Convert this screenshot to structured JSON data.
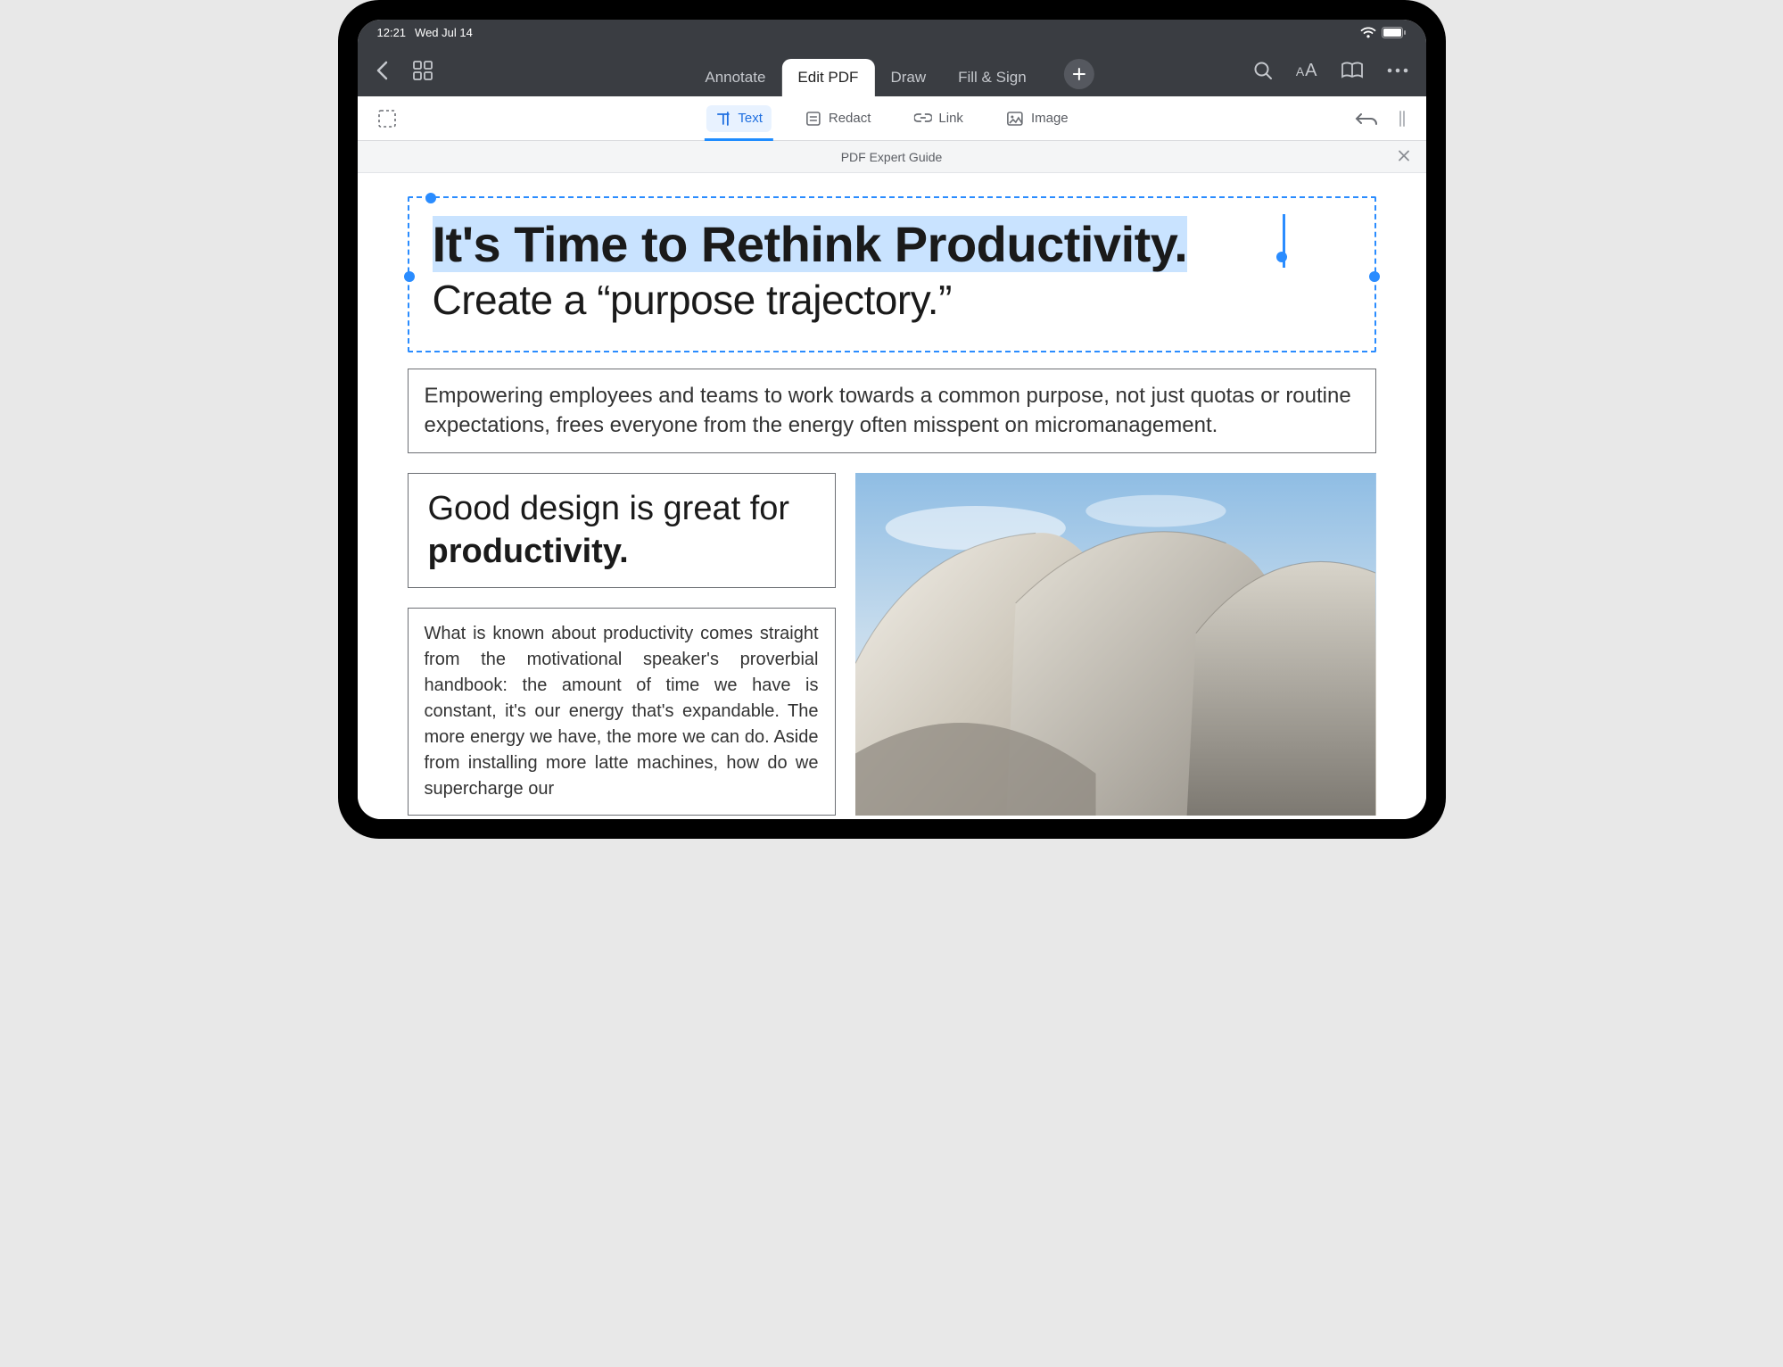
{
  "status": {
    "time": "12:21",
    "date": "Wed Jul 14"
  },
  "toolbar": {
    "tabs": [
      "Annotate",
      "Edit PDF",
      "Draw",
      "Fill & Sign"
    ],
    "active_tab_index": 1
  },
  "subtoolbar": {
    "tools": [
      {
        "label": "Text"
      },
      {
        "label": "Redact"
      },
      {
        "label": "Link"
      },
      {
        "label": "Image"
      }
    ],
    "active_tool_index": 0
  },
  "document": {
    "title": "PDF Expert Guide",
    "heading_main": "It's Time to Rethink Productivity.",
    "heading_sub": "Create a “purpose trajectory.”",
    "intro_paragraph": "Empowering employees and teams to work towards a common purpose, not just quotas or routine expectations, frees everyone from the energy often misspent on micromanagement.",
    "subheading_prefix": "Good design is great for ",
    "subheading_bold": "productivity.",
    "body_paragraph": "What is known about productivity comes straight from the motivational speaker's proverbial handbook: the amount of time we have is constant, it's our energy that's expandable. The more energy we have, the more we can do. Aside from installing more latte machines, how do we supercharge our"
  }
}
